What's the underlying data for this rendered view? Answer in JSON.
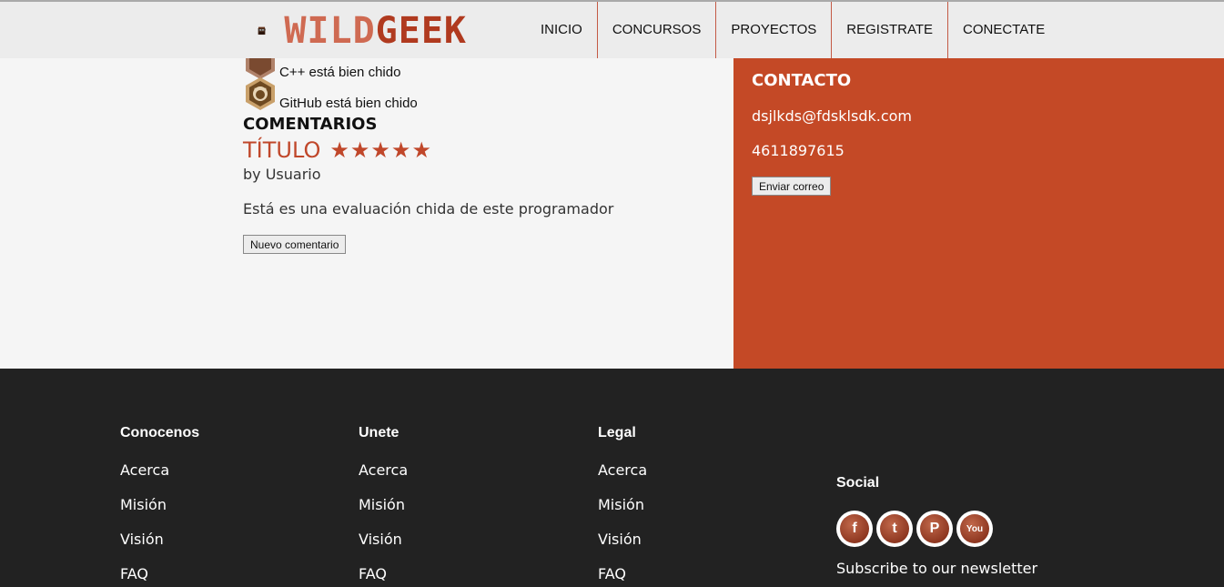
{
  "header": {
    "logo": {
      "wild": "WILD",
      "geek": "GEEK"
    },
    "nav": [
      "INICIO",
      "CONCURSOS",
      "PROYECTOS",
      "REGISTRATE",
      "CONECTATE"
    ]
  },
  "skills": [
    {
      "label": "C++ está bien chido",
      "icon": "cpp-icon"
    },
    {
      "label": "GitHub está bien chido",
      "icon": "github-icon"
    }
  ],
  "comments": {
    "section_title": "COMENTARIOS",
    "title": "TÍTULO",
    "rating": 5,
    "by": "by Usuario",
    "body": "Está es una evaluación chida de este programador",
    "new_button": "Nuevo comentario"
  },
  "contact": {
    "title": "CONTACTO",
    "email": "dsjlkds@fdsklsdk.com",
    "phone": "4611897615",
    "send_button": "Enviar correo"
  },
  "footer": {
    "columns": [
      {
        "title": "Conocenos",
        "links": [
          "Acerca",
          "Misión",
          "Visión",
          "FAQ"
        ]
      },
      {
        "title": "Unete",
        "links": [
          "Acerca",
          "Misión",
          "Visión",
          "FAQ"
        ]
      },
      {
        "title": "Legal",
        "links": [
          "Acerca",
          "Misión",
          "Visión",
          "FAQ"
        ]
      }
    ],
    "social": {
      "title": "Social",
      "icons": [
        {
          "name": "facebook-icon",
          "glyph": "f"
        },
        {
          "name": "twitter-icon",
          "glyph": "t"
        },
        {
          "name": "pinterest-icon",
          "glyph": "P"
        },
        {
          "name": "youtube-icon",
          "glyph": "You"
        }
      ],
      "subscribe": "Subscribe to our newsletter"
    }
  },
  "colors": {
    "accent": "#c44926",
    "footer": "#222222",
    "header": "#ececec"
  }
}
